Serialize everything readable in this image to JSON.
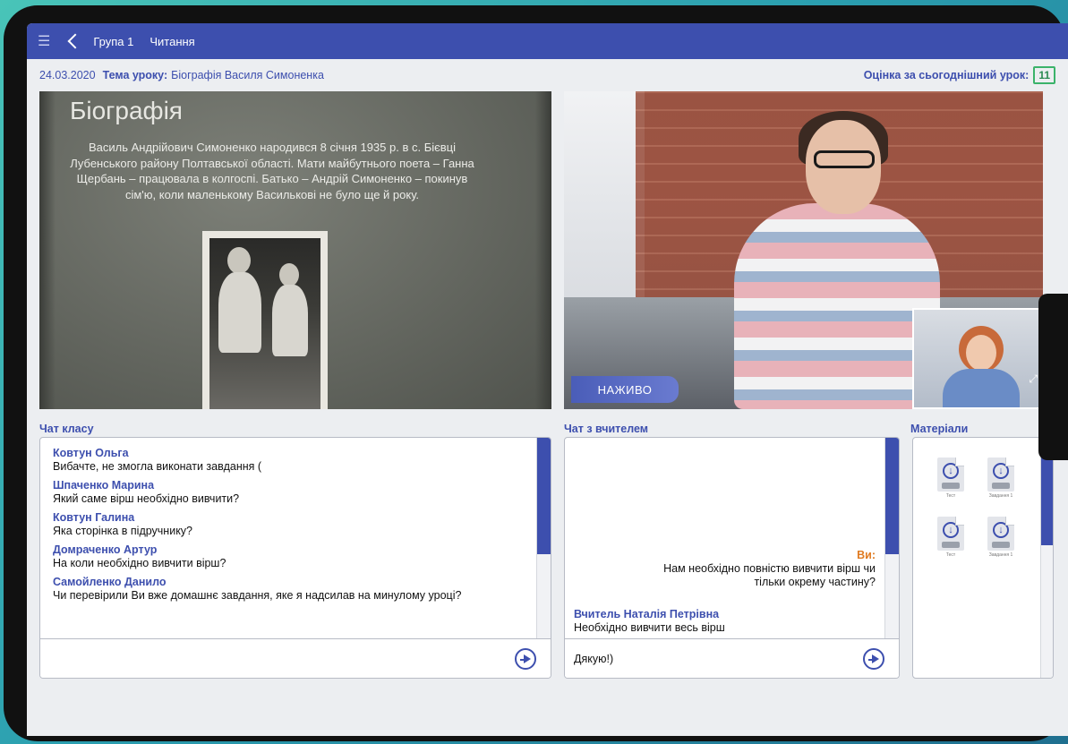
{
  "topbar": {
    "group": "Група 1",
    "subject": "Читання"
  },
  "lesson": {
    "date": "24.03.2020",
    "topic_label": "Тема уроку:",
    "topic": "Біографія Василя Симоненка",
    "grade_label": "Оцінка за сьогоднішний урок:",
    "grade": "11"
  },
  "slide": {
    "title": "Біографія",
    "text": "Василь Андрійович Симоненко народився 8 січня 1935 р. в с. Бієвці Лубенського району Полтавської області. Мати майбутнього поета – Ганна Щербань – працювала в колгоспі. Батько – Андрій Симоненко – покинув сім'ю, коли маленькому Василькові не було ще й року."
  },
  "video": {
    "live_label": "НАЖИВО"
  },
  "class_chat": {
    "label": "Чат класу",
    "messages": [
      {
        "author": "Ковтун Ольга",
        "text": "Вибачте, не змогла виконати завдання ("
      },
      {
        "author": "Шпаченко Марина",
        "text": "Який саме вірш необхідно вивчити?"
      },
      {
        "author": "Ковтун Галина",
        "text": "Яка сторінка в підручнику?"
      },
      {
        "author": "Домраченко Артур",
        "text": "На коли необхідно вивчити вірш?"
      },
      {
        "author": "Самойленко Данило",
        "text": "Чи перевірили Ви вже домашнє завдання, яке я надсилав на минулому уроці?"
      }
    ],
    "input_value": "",
    "input_placeholder": ""
  },
  "teacher_chat": {
    "label": "Чат з вчителем",
    "me_label": "Ви:",
    "me_text": "Нам необхідно повністю вивчити вірш чи тільки окрему частину?",
    "teacher_author": "Вчитель Наталія Петрівна",
    "teacher_text": "Необхідно вивчити весь вірш",
    "input_value": "Дякую!)"
  },
  "materials": {
    "label": "Матеріали",
    "files": [
      {
        "name": "Тест"
      },
      {
        "name": "Завдання 1"
      },
      {
        "name": "Тест"
      },
      {
        "name": "Завдання 1"
      }
    ]
  },
  "colors": {
    "accent": "#3d4fae",
    "grade_border": "#3bb36a",
    "me_label": "#e07b22"
  }
}
